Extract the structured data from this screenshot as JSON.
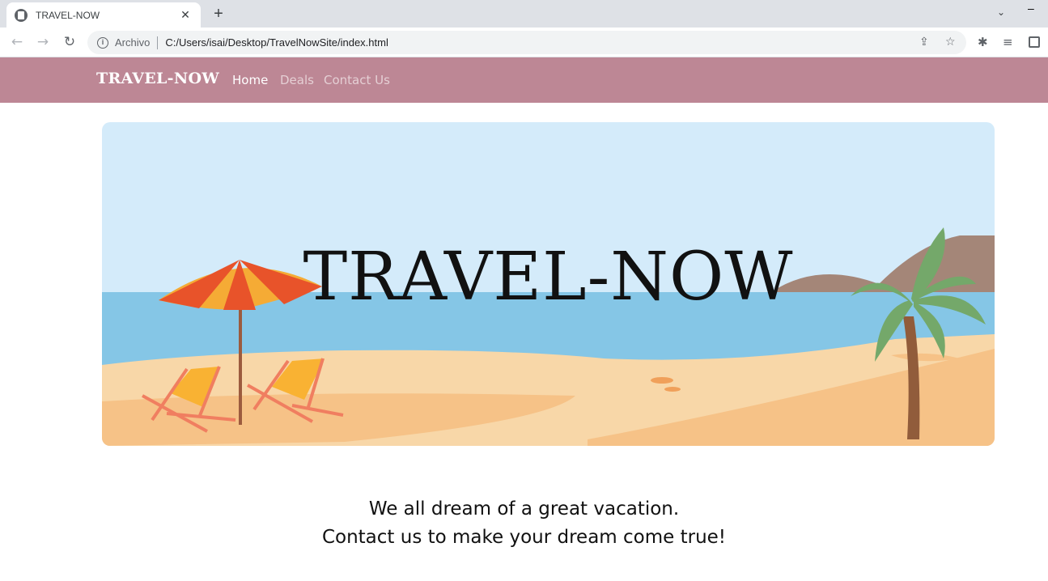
{
  "browser": {
    "tab_title": "TRAVEL-NOW",
    "origin_label": "Archivo",
    "url": "C:/Users/isai/Desktop/TravelNowSite/index.html"
  },
  "nav": {
    "brand": "TRAVEL-NOW",
    "links": [
      {
        "label": "Home",
        "active": true
      },
      {
        "label": "Deals",
        "active": false
      },
      {
        "label": "Contact Us",
        "active": false
      }
    ]
  },
  "hero": {
    "title": "TRAVEL-NOW"
  },
  "tagline": {
    "line1": "We all dream of a great vacation.",
    "line2": "Contact us to make your dream come true!"
  },
  "colors": {
    "navbar": "#bd8795",
    "sky": "#d4ebfa",
    "sea": "#85c6e6",
    "sand": "#f8d7a8"
  }
}
